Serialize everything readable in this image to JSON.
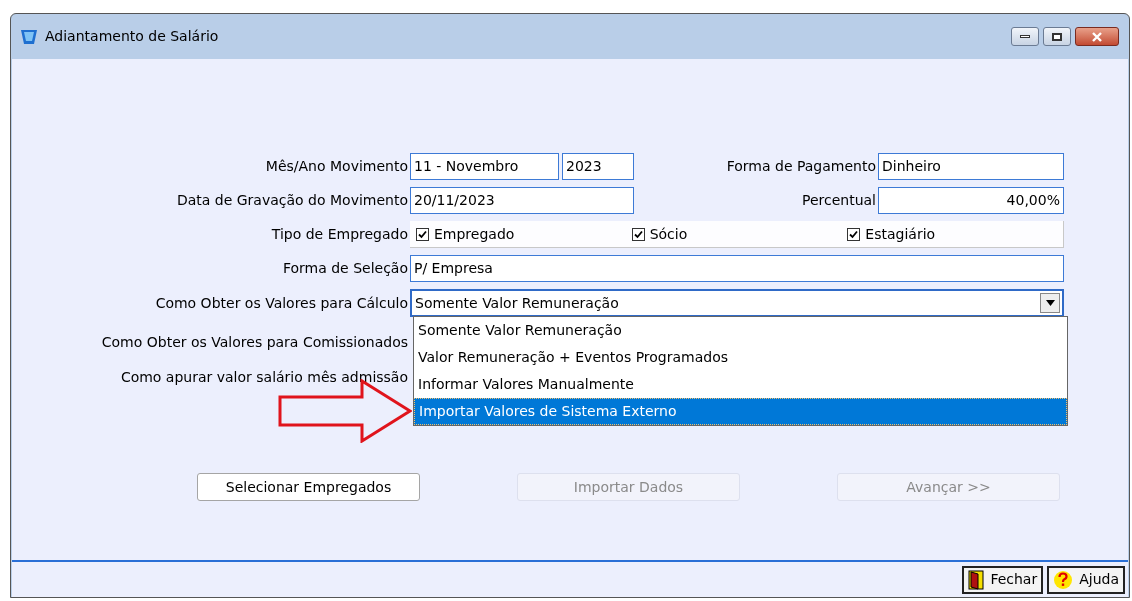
{
  "window": {
    "title": "Adiantamento de Salário"
  },
  "form": {
    "mes_ano_label": "Mês/Ano Movimento",
    "mes_value": "11 - Novembro",
    "ano_value": "2023",
    "forma_pagamento_label": "Forma de Pagamento",
    "forma_pagamento_value": "Dinheiro",
    "data_label": "Data de Gravação do Movimento",
    "data_value": "20/11/2023",
    "percentual_label": "Percentual",
    "percentual_value": "40,00%",
    "tipo_label": "Tipo de Empregado",
    "tipos": [
      {
        "label": "Empregado",
        "checked": true
      },
      {
        "label": "Sócio",
        "checked": true
      },
      {
        "label": "Estagiário",
        "checked": true
      }
    ],
    "selecao_label": "Forma de Seleção",
    "selecao_value": "P/ Empresa",
    "calculo_label": "Como Obter os Valores para Cálculo",
    "calculo_value": "Somente Valor Remuneração",
    "comissionados_label": "Como Obter os Valores para Comissionados",
    "admissao_label": "Como apurar valor salário mês admissão"
  },
  "dropdown": {
    "items": [
      {
        "label": "Somente Valor Remuneração",
        "selected": false
      },
      {
        "label": "Valor Remuneração + Eventos Programados",
        "selected": false
      },
      {
        "label": "Informar Valores Manualmente",
        "selected": false
      },
      {
        "label": "Importar Valores de Sistema Externo",
        "selected": true
      }
    ]
  },
  "buttons": [
    {
      "label": "Selecionar Empregados",
      "disabled": false
    },
    {
      "label": "Importar Dados",
      "disabled": true
    },
    {
      "label": "Avançar >>",
      "disabled": true
    }
  ],
  "footer_buttons": [
    {
      "label": "Fechar",
      "kind": "close"
    },
    {
      "label": "Ajuda",
      "kind": "help"
    }
  ]
}
